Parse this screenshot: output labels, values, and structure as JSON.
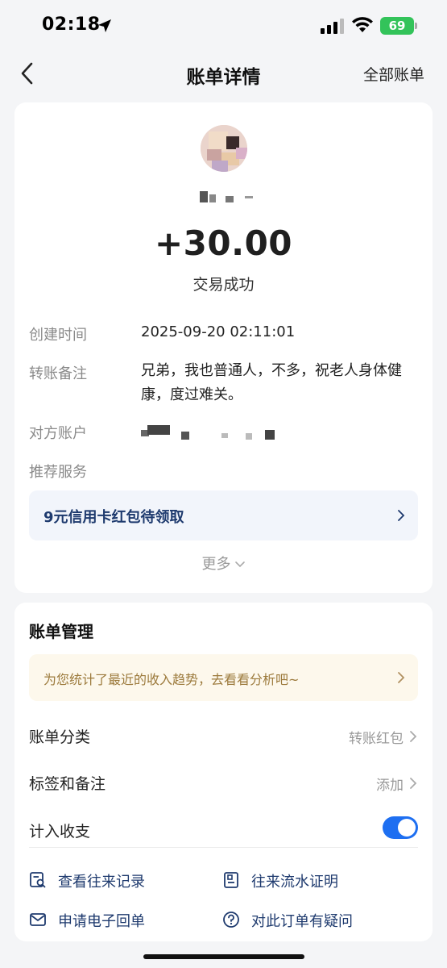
{
  "status_bar": {
    "time": "02:18",
    "battery": "69"
  },
  "nav": {
    "title": "账单详情",
    "right_action": "全部账单"
  },
  "transaction": {
    "amount": "+30.00",
    "status": "交易成功",
    "details": [
      {
        "label": "创建时间",
        "value": "2025-09-20 02:11:01"
      },
      {
        "label": "转账备注",
        "value": "兄弟，我也普通人，不多，祝老人身体健康，度过难关。"
      },
      {
        "label": "对方账户",
        "value": ""
      },
      {
        "label": "推荐服务",
        "value": ""
      }
    ],
    "promo": "9元信用卡红包待领取",
    "more": "更多"
  },
  "management": {
    "title": "账单管理",
    "trend_tip": "为您统计了最近的收入趋势，去看看分析吧~",
    "rows": [
      {
        "label": "账单分类",
        "value": "转账红包"
      },
      {
        "label": "标签和备注",
        "value": "添加"
      },
      {
        "label": "计入收支",
        "toggle_on": true
      }
    ],
    "actions": [
      {
        "label": "查看往来记录",
        "icon": "record-search-icon"
      },
      {
        "label": "往来流水证明",
        "icon": "statement-doc-icon"
      },
      {
        "label": "申请电子回单",
        "icon": "mail-icon"
      },
      {
        "label": "对此订单有疑问",
        "icon": "question-circle-icon"
      }
    ]
  },
  "colors": {
    "accent": "#1e6ff1",
    "link": "#1e3a6e",
    "battery": "#33c35a",
    "tip_bg": "#fdf8ec",
    "tip_text": "#9c7a3c"
  }
}
